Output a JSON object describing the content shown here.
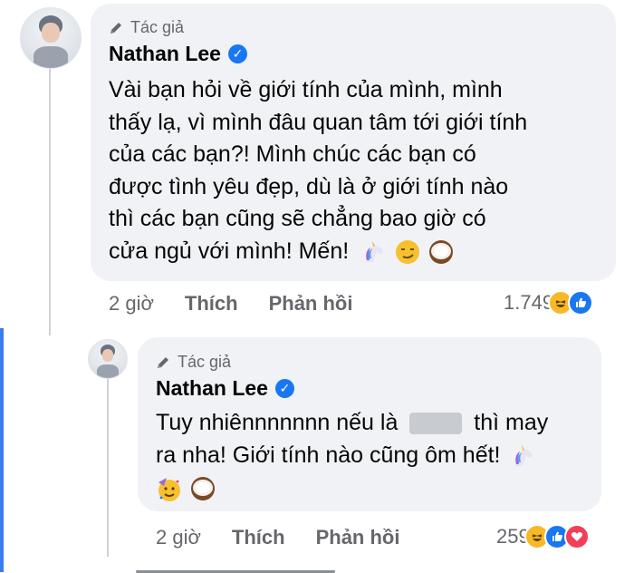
{
  "comment": {
    "author_badge": "Tác giả",
    "author_name": "Nathan Lee",
    "lines": [
      "Vài bạn hỏi về giới tính của mình, mình",
      "thấy lạ, vì mình đâu quan tâm tới giới tính",
      "của các bạn?! Mình chúc các bạn có",
      "được tình yêu đẹp, dù là ở giới tính nào",
      "thì các bạn cũng sẽ chẳng bao giờ có",
      "cửa ngủ với mình! Mến!"
    ],
    "emojis": [
      "unicorn-emoji",
      "smirk-emoji",
      "coconut-emoji"
    ],
    "time": "2 giờ",
    "like_label": "Thích",
    "reply_label": "Phản hồi",
    "reaction_count": "1.749",
    "reactions": [
      "haha",
      "like"
    ]
  },
  "reply": {
    "author_badge": "Tác giả",
    "author_name": "Nathan Lee",
    "line1_before": "Tuy nhiênnnnnnn nếu là",
    "line1_after": "thì may",
    "line2": "ra nha! Giới tính nào cũng ôm hết!",
    "emojis": [
      "unicorn-emoji",
      "party-face-emoji",
      "coconut-emoji"
    ],
    "time": "2 giờ",
    "like_label": "Thích",
    "reply_label": "Phản hồi",
    "reaction_count": "259",
    "reactions": [
      "haha",
      "like",
      "love"
    ]
  },
  "colors": {
    "bubble": "#f0f2f5",
    "verified": "#1877f2",
    "accent_bar": "#3b7cf0",
    "meta_text": "#65676b"
  }
}
